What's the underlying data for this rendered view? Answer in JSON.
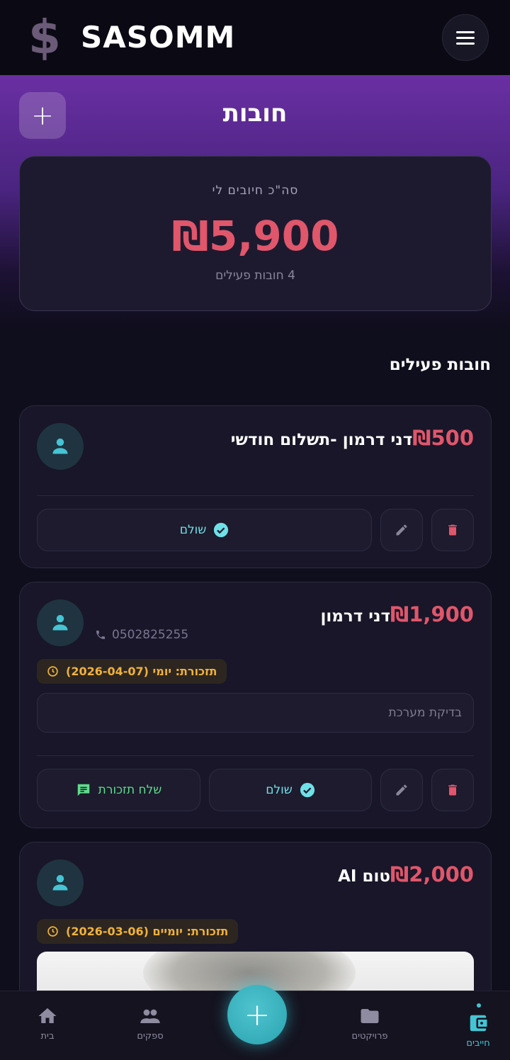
{
  "header": {
    "brand": "SASOMM",
    "logo_icon": "dollar-sign-icon"
  },
  "page": {
    "title": "חובות"
  },
  "summary": {
    "label": "סה\"כ חיובים לי",
    "amount": "₪5,900",
    "count_text": "4 חובות פעילים"
  },
  "section_title": "חובות פעילים",
  "debts": [
    {
      "amount": "₪500",
      "name": "דני דרמון -תשלום חודשי",
      "paid_label": "שולם"
    },
    {
      "amount": "₪1,900",
      "name": "דני דרמון",
      "phone": "0502825255",
      "reminder": "תזכורת: יומי (2026-04-07)",
      "note_placeholder": "בדיקת מערכת",
      "paid_label": "שולם",
      "remind_label": "שלח תזכורת"
    },
    {
      "amount": "₪2,000",
      "name": "טום AI",
      "reminder": "תזכורת: יומיים (2026-03-06)"
    }
  ],
  "nav": {
    "home": "בית",
    "suppliers": "ספקים",
    "projects": "פרויקטים",
    "debts": "חייבים"
  },
  "colors": {
    "accent_teal": "#45c4d4",
    "amount_red": "#e0566b",
    "reminder_amber": "#f0b23c",
    "hero_purple": "#6a2fa3"
  }
}
